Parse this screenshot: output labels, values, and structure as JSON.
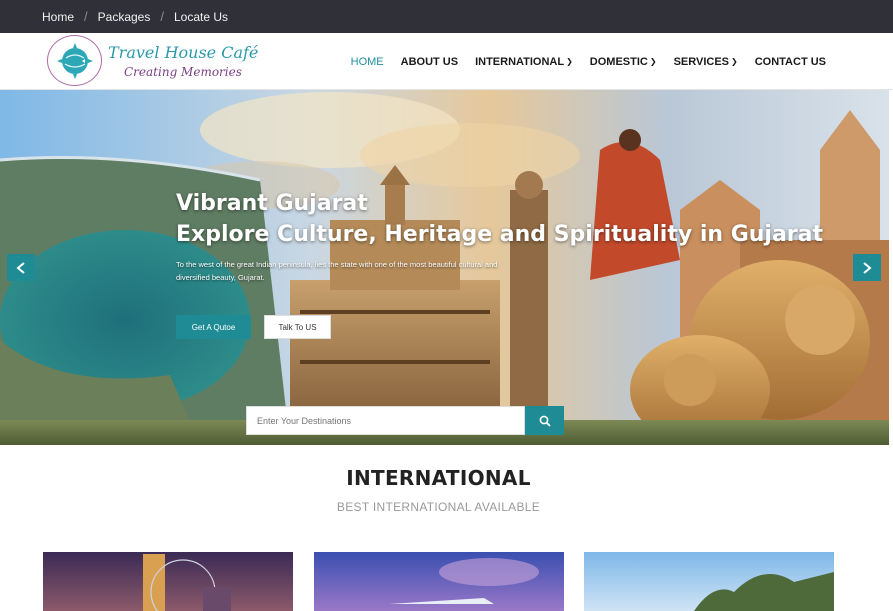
{
  "topbar": {
    "links": [
      "Home",
      "Packages",
      "Locate Us"
    ]
  },
  "brand": {
    "title": "Travel House Café",
    "subtitle": "Creating Memories"
  },
  "nav": {
    "items": [
      {
        "label": "HOME",
        "active": true
      },
      {
        "label": "ABOUT US"
      },
      {
        "label": "INTERNATIONAL",
        "dropdown": true
      },
      {
        "label": "DOMESTIC",
        "dropdown": true
      },
      {
        "label": "SERVICES",
        "dropdown": true
      },
      {
        "label": "CONTACT US"
      }
    ]
  },
  "hero": {
    "title_line1": "Vibrant Gujarat",
    "title_line2": "Explore Culture, Heritage and Spirituality in Gujarat",
    "text": "To the west of the great Indian peninsula, lies the state with one of the most beautiful cultural and diversified beauty, Gujarat.",
    "quote_button": "Get A Qutoe",
    "talk_button": "Talk To US",
    "prev_icon": "chevron-left-icon",
    "next_icon": "chevron-right-icon"
  },
  "search": {
    "placeholder": "Enter Your Destinations",
    "icon": "search-icon"
  },
  "section": {
    "title": "INTERNATIONAL",
    "subtitle": "BEST INTERNATIONAL AVAILABLE"
  },
  "colors": {
    "accent": "#1f8c95",
    "topbar": "#2f3038"
  }
}
